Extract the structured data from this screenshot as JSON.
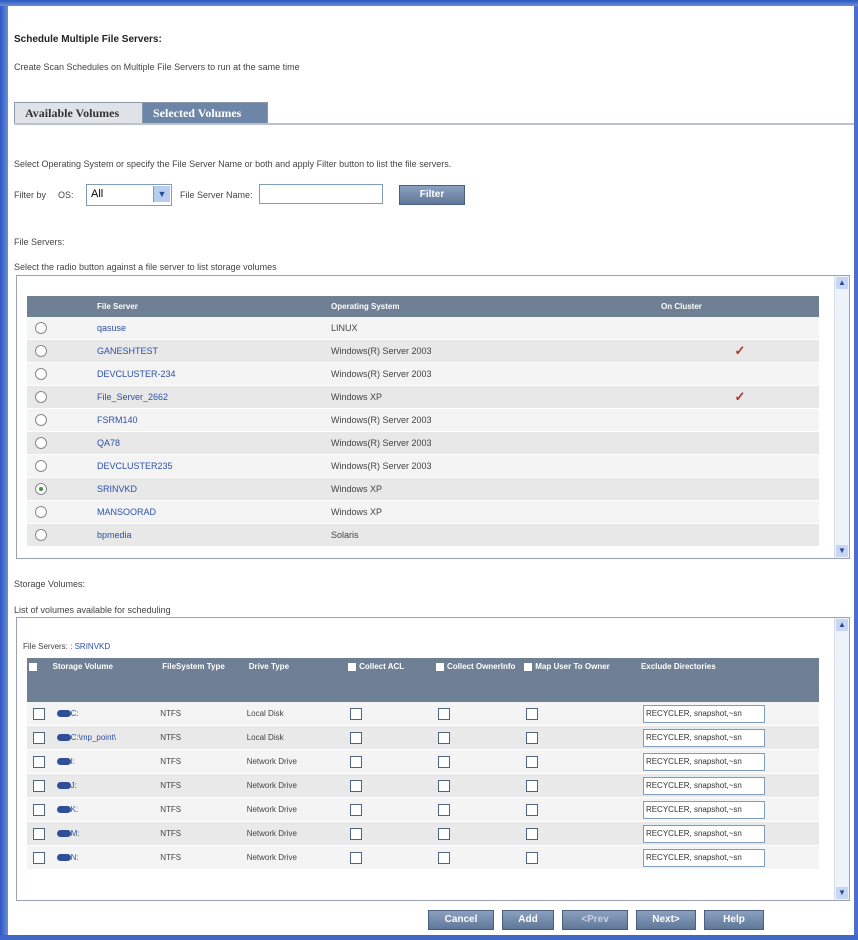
{
  "page": {
    "title": "Schedule Multiple File Servers:",
    "description": "Create Scan Schedules on Multiple File Servers to run at the same time"
  },
  "tabs": [
    {
      "label": "Available Volumes",
      "active": false
    },
    {
      "label": "Selected Volumes",
      "active": true
    }
  ],
  "filter": {
    "instruction": "Select Operating System or specify the File Server Name or both and apply Filter button to list the file servers.",
    "filter_by_label": "Filter by",
    "os_label": "OS:",
    "os_value": "All",
    "server_name_label": "File Server Name:",
    "server_name_value": "",
    "filter_button": "Filter"
  },
  "file_servers": {
    "section_label": "File Servers:",
    "hint": "Select the radio button against a file server to list storage volumes",
    "columns": [
      "File Server",
      "Operating System",
      "On Cluster"
    ],
    "rows": [
      {
        "name": "qasuse",
        "os": "LINUX",
        "cluster": "",
        "selected": false
      },
      {
        "name": "GANESHTEST",
        "os": "Windows(R) Server 2003",
        "cluster": "✓",
        "selected": false
      },
      {
        "name": "DEVCLUSTER-234",
        "os": "Windows(R) Server 2003",
        "cluster": "",
        "selected": false
      },
      {
        "name": "File_Server_2662",
        "os": "Windows XP",
        "cluster": "✓",
        "selected": false
      },
      {
        "name": "FSRM140",
        "os": "Windows(R) Server 2003",
        "cluster": "",
        "selected": false
      },
      {
        "name": "QA78",
        "os": "Windows(R) Server 2003",
        "cluster": "",
        "selected": false
      },
      {
        "name": "DEVCLUSTER235",
        "os": "Windows(R) Server 2003",
        "cluster": "",
        "selected": false
      },
      {
        "name": "SRINVKD",
        "os": "Windows XP",
        "cluster": "",
        "selected": true
      },
      {
        "name": "MANSOORAD",
        "os": "Windows XP",
        "cluster": "",
        "selected": false
      },
      {
        "name": "bpmedia",
        "os": "Solaris",
        "cluster": "",
        "selected": false
      }
    ]
  },
  "storage_volumes": {
    "section_label": "Storage Volumes:",
    "hint": "List of volumes available for scheduling",
    "file_servers_label": "File Servers: :",
    "file_servers_value": "SRINVKD",
    "columns": {
      "storage_volume": "Storage Volume",
      "fs_type": "FileSystem Type",
      "drive_type": "Drive Type",
      "collect_acl": "Collect ACL",
      "collect_owner": "Collect OwnerInfo",
      "map_user": "Map User To Owner",
      "exclude": "Exclude Directories"
    },
    "rows": [
      {
        "volume": "C:",
        "fs": "NTFS",
        "drive": "Local Disk",
        "exclude": "RECYCLER, snapshot,~sn"
      },
      {
        "volume": "C:\\mp_point\\",
        "fs": "NTFS",
        "drive": "Local Disk",
        "exclude": "RECYCLER, snapshot,~sn"
      },
      {
        "volume": "I:",
        "fs": "NTFS",
        "drive": "Network Drive",
        "exclude": "RECYCLER, snapshot,~sn"
      },
      {
        "volume": "J:",
        "fs": "NTFS",
        "drive": "Network Drive",
        "exclude": "RECYCLER, snapshot,~sn"
      },
      {
        "volume": "K:",
        "fs": "NTFS",
        "drive": "Network Drive",
        "exclude": "RECYCLER, snapshot,~sn"
      },
      {
        "volume": "M:",
        "fs": "NTFS",
        "drive": "Network Drive",
        "exclude": "RECYCLER, snapshot,~sn"
      },
      {
        "volume": "N:",
        "fs": "NTFS",
        "drive": "Network Drive",
        "exclude": "RECYCLER, snapshot,~sn"
      }
    ]
  },
  "buttons": {
    "cancel": "Cancel",
    "add": "Add",
    "prev": "<Prev",
    "next": "Next>",
    "help": "Help"
  },
  "colors": {
    "header_bg": "#6f7f94",
    "tab_active": "#6d86a8",
    "link": "#2b4fa8",
    "check": "#b8322c"
  }
}
